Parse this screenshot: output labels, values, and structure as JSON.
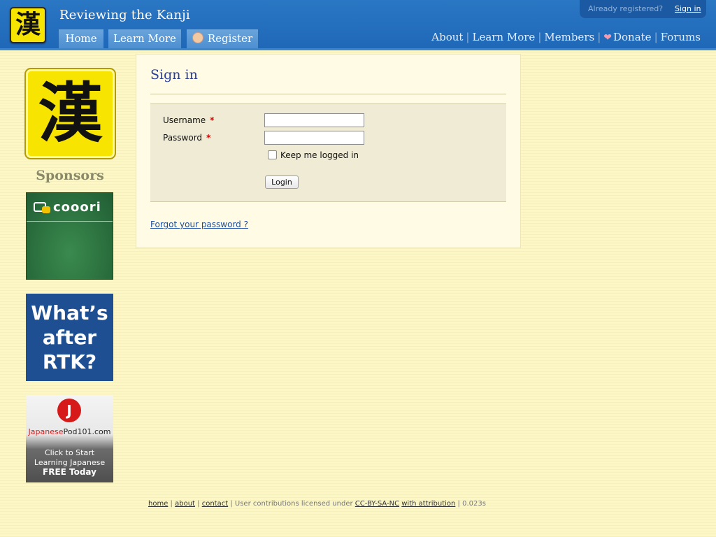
{
  "header": {
    "logo_char": "漢",
    "site_title": "Reviewing the Kanji",
    "tabs": [
      {
        "label": "Home"
      },
      {
        "label": "Learn More"
      },
      {
        "label": "Register"
      }
    ],
    "signin_bar": {
      "already_text": "Already registered?",
      "signin_label": "Sign in"
    },
    "right_nav": {
      "about": "About",
      "learn_more": "Learn More",
      "members": "Members",
      "donate": "Donate",
      "forums": "Forums",
      "separator": "|"
    }
  },
  "sidebar": {
    "logo_char": "漢",
    "sponsors_title": "Sponsors",
    "sponsors": [
      {
        "name": "cooori"
      },
      {
        "lines": [
          "What’s",
          "after",
          "RTK?"
        ]
      },
      {
        "brand_red": "Japanese",
        "brand_rest": "Pod101.com",
        "line1": "Click to Start",
        "line2": "Learning Japanese",
        "line3": "FREE Today"
      }
    ]
  },
  "main": {
    "title": "Sign in",
    "form": {
      "username_label": "Username",
      "password_label": "Password",
      "required_mark": "*",
      "username_value": "",
      "password_value": "",
      "remember_label": "Keep me logged in",
      "remember_checked": false,
      "login_label": "Login"
    },
    "forgot_link": "Forgot your password ?"
  },
  "footer": {
    "home": "home",
    "about": "about",
    "contact": "contact",
    "sep": "|",
    "license_text": "User contributions licensed under",
    "license_link": "CC-BY-SA-NC",
    "attribution_link": "with attribution",
    "timing": "| 0.023s"
  },
  "colors": {
    "header_blue": "#1f68b8",
    "page_background": "#fcf7c4",
    "title_blue": "#2a3f9c",
    "logo_yellow": "#f7e400"
  },
  "icons": [
    "kanji-logo-icon",
    "user-icon",
    "heart-icon",
    "checkbox-icon"
  ]
}
